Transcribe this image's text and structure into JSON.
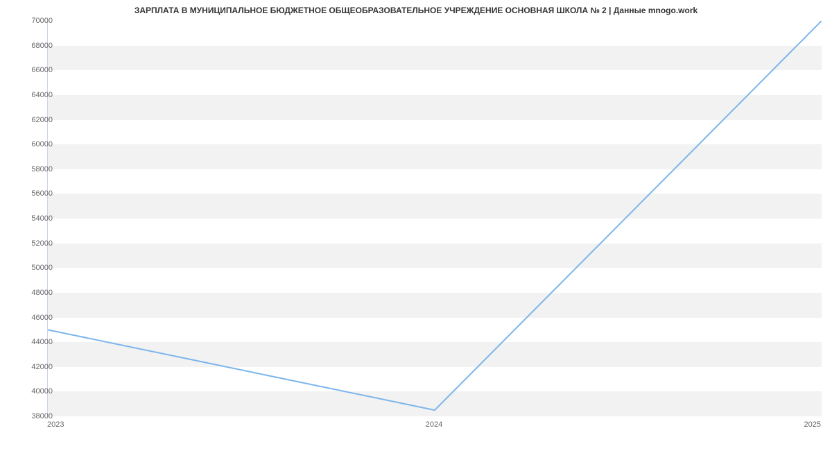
{
  "chart_data": {
    "type": "line",
    "title": "ЗАРПЛАТА В МУНИЦИПАЛЬНОЕ БЮДЖЕТНОЕ ОБЩЕОБРАЗОВАТЕЛЬНОЕ УЧРЕЖДЕНИЕ ОСНОВНАЯ ШКОЛА № 2 | Данные mnogo.work",
    "xlabel": "",
    "ylabel": "",
    "x_categories": [
      "2023",
      "2024",
      "2025"
    ],
    "values": [
      45000,
      38500,
      70000
    ],
    "ylim": [
      38000,
      70000
    ],
    "y_ticks": [
      38000,
      40000,
      42000,
      44000,
      46000,
      48000,
      50000,
      52000,
      54000,
      56000,
      58000,
      60000,
      62000,
      64000,
      66000,
      68000,
      70000
    ],
    "grid": true,
    "line_color": "#7cb5ec"
  }
}
